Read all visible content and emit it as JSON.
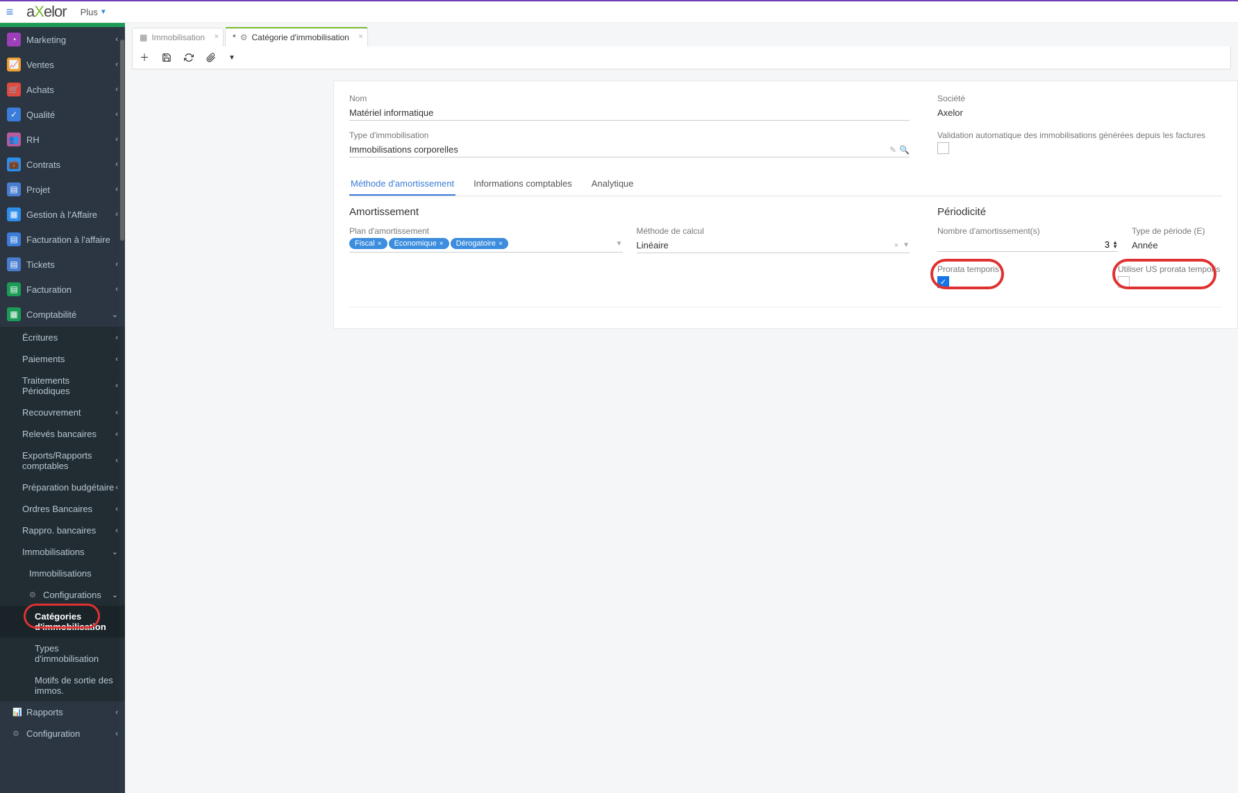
{
  "header": {
    "brand_a": "a",
    "brand_x": "X",
    "brand_rest": "elor",
    "plus": "Plus"
  },
  "sidebar": {
    "top": [
      {
        "label": "Marketing",
        "color": "#9c3fb8"
      },
      {
        "label": "Ventes",
        "color": "#f0a030"
      },
      {
        "label": "Achats",
        "color": "#e04a3f"
      },
      {
        "label": "Qualité",
        "color": "#3b7dd8"
      },
      {
        "label": "RH",
        "color": "#b85c9e"
      },
      {
        "label": "Contrats",
        "color": "#2f8deb"
      },
      {
        "label": "Projet",
        "color": "#4a7dd0"
      },
      {
        "label": "Gestion à l'Affaire",
        "color": "#2f8deb"
      },
      {
        "label": "Facturation à l'affaire",
        "color": "#3b7dd8"
      },
      {
        "label": "Tickets",
        "color": "#4a7dd0"
      },
      {
        "label": "Facturation",
        "color": "#1c9b56"
      }
    ],
    "compta": "Comptabilité",
    "compta_children": [
      "Écritures",
      "Paiements",
      "Traitements Périodiques",
      "Recouvrement",
      "Relevés bancaires",
      "Exports/Rapports comptables",
      "Préparation budgétaire",
      "Ordres Bancaires",
      "Rappro. bancaires",
      "Immobilisations"
    ],
    "immob_sub": "Immobilisations",
    "config": "Configurations",
    "config_children": [
      "Catégories d'immobilisation",
      "Types d'immobilisation",
      "Motifs de sortie des immos."
    ],
    "rapports": "Rapports",
    "configuration": "Configuration"
  },
  "tabs": [
    {
      "label": "Immobilisation",
      "active": false
    },
    {
      "label": "Catégorie d'immobilisation",
      "active": true,
      "dirty": "*"
    }
  ],
  "form": {
    "name_label": "Nom",
    "name_value": "Matériel informatique",
    "type_label": "Type d'immobilisation",
    "type_value": "Immobilisations corporelles",
    "company_label": "Société",
    "company_value": "Axelor",
    "autoValid_label": "Validation automatique des immobilisations générées depuis les factures",
    "inner_tabs": [
      "Méthode d'amortissement",
      "Informations comptables",
      "Analytique"
    ],
    "amort_head": "Amortissement",
    "plan_label": "Plan d'amortissement",
    "plan_tags": [
      "Fiscal",
      "Economique",
      "Dérogatoire"
    ],
    "calc_label": "Méthode de calcul",
    "calc_value": "Linéaire",
    "period_head": "Périodicité",
    "nbamort_label": "Nombre d'amortissement(s)",
    "nbamort_value": "3",
    "typeper_label": "Type de période (E)",
    "typeper_value": "Année",
    "prorata_label": "Prorata temporis",
    "usprorata_label": "Utiliser US prorata temporis"
  }
}
